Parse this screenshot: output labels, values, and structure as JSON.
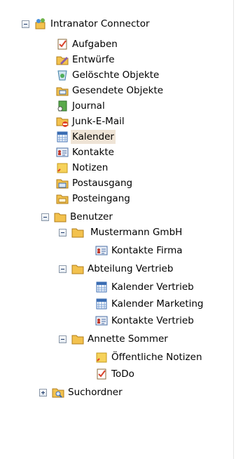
{
  "tree": {
    "root": {
      "label": "Intranator Connector",
      "icon": "mailbox-icon"
    },
    "items": [
      {
        "key": "aufgaben",
        "label": "Aufgaben",
        "icon": "tasks-icon"
      },
      {
        "key": "entwuerfe",
        "label": "Entwürfe",
        "icon": "drafts-icon"
      },
      {
        "key": "geloeschte",
        "label": "Gelöschte Objekte",
        "icon": "trash-icon"
      },
      {
        "key": "gesendete",
        "label": "Gesendete Objekte",
        "icon": "sent-folder-icon"
      },
      {
        "key": "journal",
        "label": "Journal",
        "icon": "journal-icon"
      },
      {
        "key": "junk",
        "label": "Junk-E-Mail",
        "icon": "junk-folder-icon"
      },
      {
        "key": "kalender",
        "label": "Kalender",
        "icon": "calendar-icon",
        "selected": true
      },
      {
        "key": "kontakte",
        "label": "Kontakte",
        "icon": "contacts-icon"
      },
      {
        "key": "notizen",
        "label": "Notizen",
        "icon": "notes-icon"
      },
      {
        "key": "postausgang",
        "label": "Postausgang",
        "icon": "outbox-icon"
      },
      {
        "key": "posteingang",
        "label": "Posteingang",
        "icon": "inbox-icon"
      },
      {
        "key": "benutzer",
        "label": "Benutzer",
        "icon": "folder-icon"
      },
      {
        "key": "mustermann",
        "label": "Mustermann GmbH",
        "icon": "folder-icon"
      },
      {
        "key": "kontakte-firma",
        "label": "Kontakte Firma",
        "icon": "contacts-icon"
      },
      {
        "key": "abteilung",
        "label": "Abteilung Vertrieb",
        "icon": "folder-icon"
      },
      {
        "key": "kal-vertrieb",
        "label": "Kalender Vertrieb",
        "icon": "calendar-icon"
      },
      {
        "key": "kal-marketing",
        "label": "Kalender Marketing",
        "icon": "calendar-icon"
      },
      {
        "key": "kontakte-vertrieb",
        "label": "Kontakte Vertrieb",
        "icon": "contacts-icon"
      },
      {
        "key": "annette",
        "label": "Annette Sommer",
        "icon": "folder-icon"
      },
      {
        "key": "oeff-notizen",
        "label": "Öffentliche Notizen",
        "icon": "notes-icon"
      },
      {
        "key": "todo",
        "label": "ToDo",
        "icon": "tasks-icon"
      },
      {
        "key": "suchordner",
        "label": "Suchordner",
        "icon": "search-folder-icon"
      }
    ]
  },
  "colors": {
    "selection": "#efe4d6",
    "folder": "#f3c24e",
    "toggle_sign": "#1d3a6b"
  }
}
